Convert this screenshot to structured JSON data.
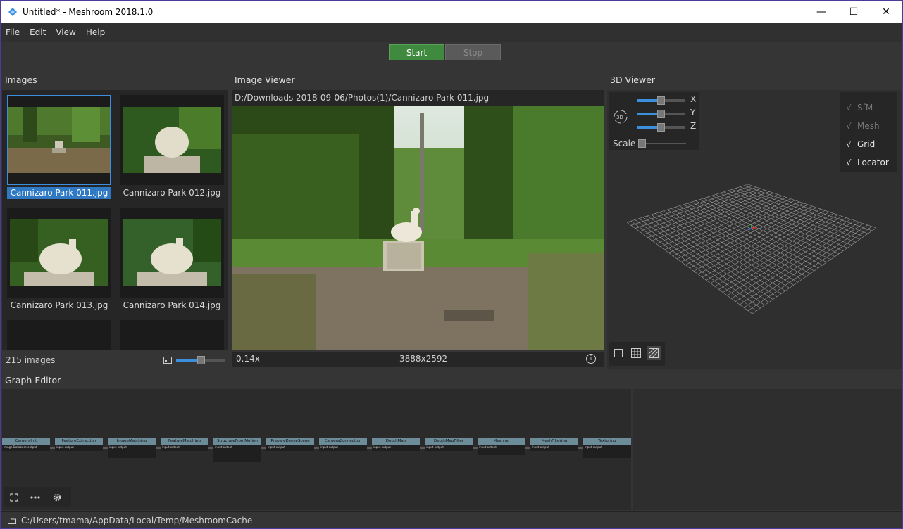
{
  "window": {
    "title": "Untitled* - Meshroom 2018.1.0",
    "minimize_glyph": "—",
    "maximize_glyph": "☐",
    "close_glyph": "✕"
  },
  "menu": [
    "File",
    "Edit",
    "View",
    "Help"
  ],
  "toolbar": {
    "start_label": "Start",
    "stop_label": "Stop"
  },
  "images_panel": {
    "title": "Images",
    "thumbnails": [
      {
        "label": "Cannizaro Park 011.jpg",
        "selected": true
      },
      {
        "label": "Cannizaro Park 012.jpg",
        "selected": false
      },
      {
        "label": "Cannizaro Park 013.jpg",
        "selected": false
      },
      {
        "label": "Cannizaro Park 014.jpg",
        "selected": false
      },
      {
        "label": "",
        "selected": false
      },
      {
        "label": "",
        "selected": false
      }
    ],
    "count_label": "215 images",
    "thumbnail_size_fraction": 0.5
  },
  "image_viewer": {
    "title": "Image Viewer",
    "path": "D:/Downloads 2018-09-06/Photos(1)/Cannizaro Park 011.jpg",
    "zoom": "0.14x",
    "resolution": "3888x2592",
    "info_glyph": "i"
  },
  "viewer3d": {
    "title": "3D Viewer",
    "axes": [
      {
        "label": "X",
        "value_fraction": 0.5
      },
      {
        "label": "Y",
        "value_fraction": 0.5
      },
      {
        "label": "Z",
        "value_fraction": 0.5
      }
    ],
    "scale_label": "Scale",
    "scale_fraction": 0.0,
    "badge_3d": "3D",
    "visibility": [
      {
        "label": "SfM",
        "enabled": false
      },
      {
        "label": "Mesh",
        "enabled": false
      },
      {
        "label": "Grid",
        "enabled": true
      },
      {
        "label": "Locator",
        "enabled": true
      }
    ],
    "check_glyph": "√"
  },
  "graph_editor": {
    "title": "Graph Editor",
    "nodes": [
      {
        "name": "CameraInit",
        "row1": "Image Database",
        "row2": "output"
      },
      {
        "name": "FeatureExtraction",
        "row1": "input",
        "row2": "output"
      },
      {
        "name": "ImageMatching",
        "row1": "input",
        "row2": "output"
      },
      {
        "name": "FeatureMatching",
        "row1": "input",
        "row2": "output"
      },
      {
        "name": "StructureFromMotion",
        "row1": "input",
        "row2": "output"
      },
      {
        "name": "PrepareDenseScene",
        "row1": "input",
        "row2": "output"
      },
      {
        "name": "CameraConnection",
        "row1": "input",
        "row2": "output"
      },
      {
        "name": "DepthMap",
        "row1": "input",
        "row2": "output"
      },
      {
        "name": "DepthMapFilter",
        "row1": "input",
        "row2": "output"
      },
      {
        "name": "Meshing",
        "row1": "input",
        "row2": "output"
      },
      {
        "name": "MeshFiltering",
        "row1": "input",
        "row2": "output"
      },
      {
        "name": "Texturing",
        "row1": "input",
        "row2": "output"
      }
    ]
  },
  "status": {
    "cache_path": "C:/Users/tmama/AppData/Local/Temp/MeshroomCache"
  },
  "colors": {
    "accent": "#3c8fde",
    "start_green": "#3f8a3e",
    "node_header": "#6c8c9a"
  }
}
